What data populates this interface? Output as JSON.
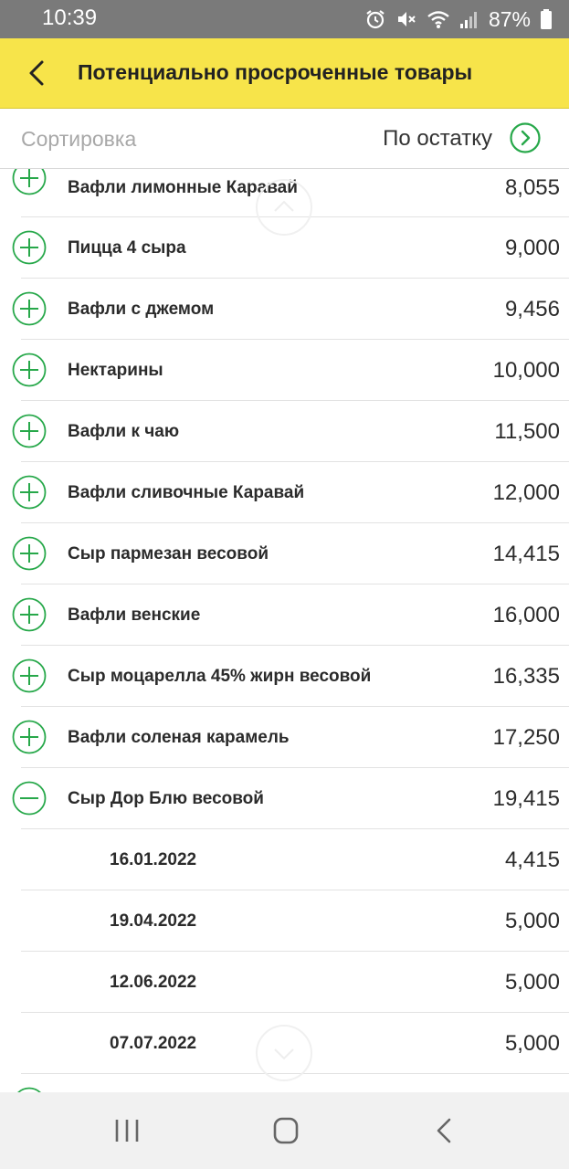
{
  "status_bar": {
    "time": "10:39",
    "battery": "87%",
    "icons": [
      "alarm-icon",
      "mute-icon",
      "wifi-icon",
      "signal-icon",
      "battery-icon"
    ]
  },
  "header": {
    "title": "Потенциально просроченные товары",
    "back_icon": "back-arrow-icon"
  },
  "sort": {
    "label": "Сортировка",
    "value": "По остатку",
    "icon": "chevron-right-circle-icon"
  },
  "items": [
    {
      "name": "Вафли лимонные Каравай",
      "qty": "8,055",
      "state": "collapsed"
    },
    {
      "name": "Пицца 4 сыра",
      "qty": "9,000",
      "state": "collapsed"
    },
    {
      "name": "Вафли с джемом",
      "qty": "9,456",
      "state": "collapsed"
    },
    {
      "name": "Нектарины",
      "qty": "10,000",
      "state": "collapsed"
    },
    {
      "name": "Вафли к чаю",
      "qty": "11,500",
      "state": "collapsed"
    },
    {
      "name": "Вафли сливочные Каравай",
      "qty": "12,000",
      "state": "collapsed"
    },
    {
      "name": "Сыр пармезан  весовой",
      "qty": "14,415",
      "state": "collapsed"
    },
    {
      "name": "Вафли венские",
      "qty": "16,000",
      "state": "collapsed"
    },
    {
      "name": "Сыр моцарелла 45% жирн весовой",
      "qty": "16,335",
      "state": "collapsed"
    },
    {
      "name": "Вафли соленая карамель",
      "qty": "17,250",
      "state": "collapsed"
    },
    {
      "name": "Сыр Дор Блю весовой",
      "qty": "19,415",
      "state": "expanded"
    }
  ],
  "sub_items": [
    {
      "date": "16.01.2022",
      "qty": "4,415"
    },
    {
      "date": "19.04.2022",
      "qty": "5,000"
    },
    {
      "date": "12.06.2022",
      "qty": "5,000"
    },
    {
      "date": "07.07.2022",
      "qty": "5,000"
    }
  ],
  "colors": {
    "header": "#f7e44a",
    "accent_green": "#27a84a",
    "status_bar": "#7a7a7a"
  },
  "nav_bar": {
    "icons": [
      "recent-apps-icon",
      "home-icon",
      "back-icon"
    ]
  }
}
